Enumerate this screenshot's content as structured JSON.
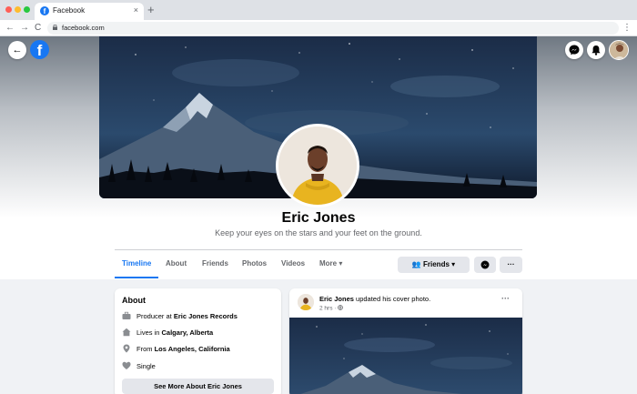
{
  "browser": {
    "tab_title": "Facebook",
    "tab_favicon": "f",
    "tab_close": "×",
    "new_tab": "+",
    "url": "facebook.com",
    "back": "←",
    "forward": "→",
    "reload": "C",
    "menu": "⋮"
  },
  "topnav": {
    "back": "←",
    "logo": "f"
  },
  "profile": {
    "name": "Eric Jones",
    "bio": "Keep your eyes on the stars and your feet on the ground."
  },
  "tabs": [
    {
      "label": "Timeline",
      "active": true
    },
    {
      "label": "About"
    },
    {
      "label": "Friends"
    },
    {
      "label": "Photos"
    },
    {
      "label": "Videos"
    },
    {
      "label": "More ▾"
    }
  ],
  "actions": {
    "friends": "👥 Friends ▾",
    "more": "···"
  },
  "about": {
    "title": "About",
    "rows": [
      {
        "icon": "briefcase-icon",
        "prefix": "Producer at ",
        "value": "Eric Jones Records"
      },
      {
        "icon": "home-icon",
        "prefix": "Lives in ",
        "value": "Calgary, Alberta"
      },
      {
        "icon": "location-pin-icon",
        "prefix": "From ",
        "value": "Los Angeles, California"
      },
      {
        "icon": "heart-icon",
        "prefix": "Single",
        "value": ""
      }
    ],
    "see_more": "See More About Eric Jones"
  },
  "post": {
    "author": "Eric Jones",
    "action": " updated his cover photo.",
    "time": "2 hrs · ",
    "menu": "···"
  },
  "colors": {
    "accent": "#1877f2",
    "sky_dark": "#1a2b45",
    "shirt": "#e8b420"
  }
}
